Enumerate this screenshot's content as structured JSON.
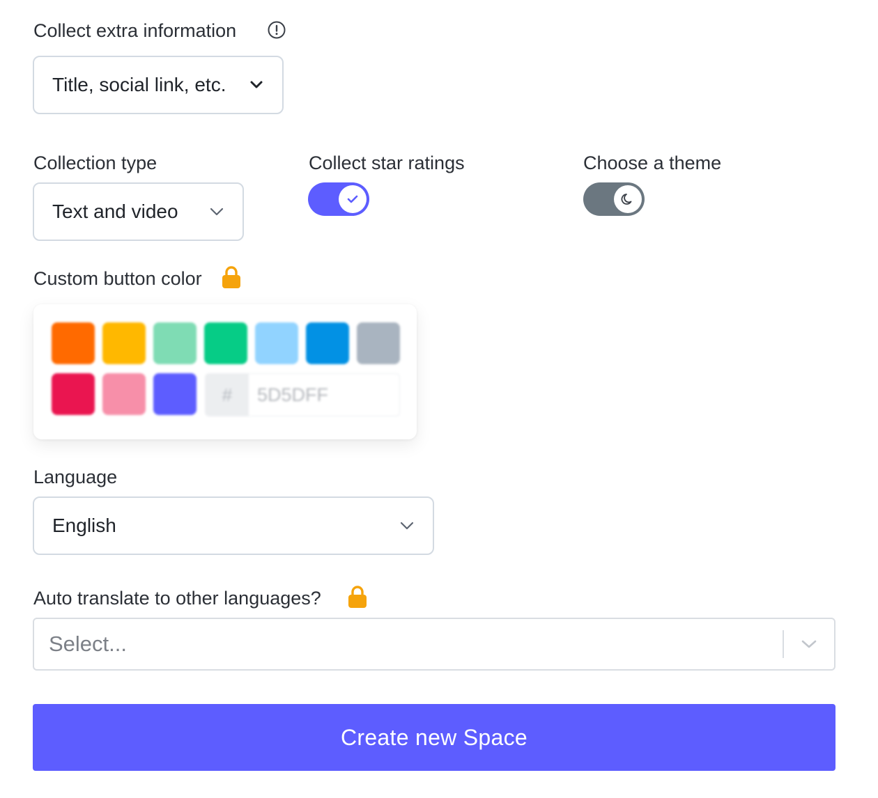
{
  "extra_info": {
    "label": "Collect extra information",
    "select_value": "Title, social link, etc."
  },
  "collection_type": {
    "label": "Collection type",
    "select_value": "Text and video"
  },
  "star_ratings": {
    "label": "Collect star ratings",
    "enabled": true
  },
  "theme": {
    "label": "Choose a theme",
    "mode": "dark"
  },
  "button_color": {
    "label": "Custom button color",
    "locked": true,
    "swatches": [
      "#ff6a00",
      "#ffb800",
      "#7fdcb4",
      "#06cc86",
      "#91d3ff",
      "#0291e4",
      "#a9b4c0",
      "#ea1550",
      "#f78fa9",
      "#5d5dff"
    ],
    "hash_symbol": "#",
    "hex_value": "5D5DFF"
  },
  "language": {
    "label": "Language",
    "select_value": "English"
  },
  "auto_translate": {
    "label": "Auto translate to other languages?",
    "locked": true,
    "placeholder": "Select..."
  },
  "submit": {
    "label": "Create new Space"
  },
  "colors": {
    "accent": "#5d5dff",
    "toggle_off": "#6b7780",
    "lock": "#f5a30c"
  }
}
